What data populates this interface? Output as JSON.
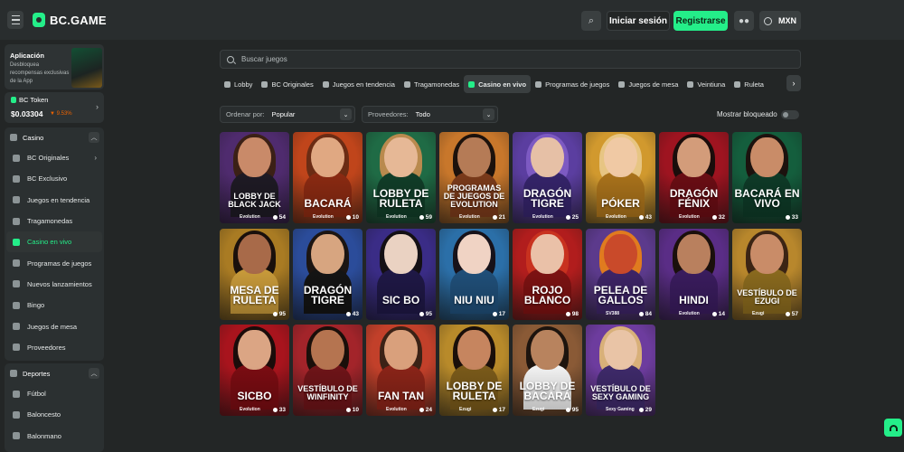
{
  "header": {
    "logo_text": "BC.GAME",
    "login_label": "Iniciar sesión",
    "register_label": "Registrarse",
    "currency": "MXN"
  },
  "sidebar": {
    "app": {
      "title": "Aplicación",
      "desc": "Desbloquea recompensas exclusivas de la App"
    },
    "token": {
      "name": "BC Token",
      "price": "$0.03304",
      "change": "9.53%"
    },
    "casino": {
      "title": "Casino",
      "items": [
        {
          "label": "BC Originales",
          "icon": "bc-originals-icon",
          "chevron": "›"
        },
        {
          "label": "BC Exclusivo",
          "icon": "exclusive-icon"
        },
        {
          "label": "Juegos en tendencia",
          "icon": "fire-icon"
        },
        {
          "label": "Tragamonedas",
          "icon": "slots-icon"
        },
        {
          "label": "Casino en vivo",
          "icon": "live-casino-icon"
        },
        {
          "label": "Programas de juegos",
          "icon": "game-shows-icon"
        },
        {
          "label": "Nuevos lanzamientos",
          "icon": "new-releases-icon"
        },
        {
          "label": "Bingo",
          "icon": "bingo-icon"
        },
        {
          "label": "Juegos de mesa",
          "icon": "table-games-icon"
        },
        {
          "label": "Proveedores",
          "icon": "providers-icon"
        }
      ]
    },
    "sports": {
      "title": "Deportes",
      "items": [
        {
          "label": "Fútbol",
          "icon": "soccer-icon"
        },
        {
          "label": "Baloncesto",
          "icon": "basketball-icon"
        },
        {
          "label": "Balonmano",
          "icon": "handball-icon"
        }
      ]
    }
  },
  "search": {
    "placeholder": "Buscar juegos"
  },
  "tabs": [
    "Lobby",
    "BC Originales",
    "Juegos en tendencia",
    "Tragamonedas",
    "Casino en vivo",
    "Programas de juegos",
    "Juegos de mesa",
    "Veintiuna",
    "Ruleta"
  ],
  "filters": {
    "sort_label": "Ordenar por:",
    "sort_value": "Popular",
    "provider_label": "Proveedores:",
    "provider_value": "Todo",
    "show_locked": "Mostrar bloqueado"
  },
  "games": [
    {
      "title": "Lobby de Black Jack",
      "provider": "Evolution",
      "players": "54",
      "bg": "#4f2b6e",
      "skin": "#c98a69",
      "hair": "#3b2016",
      "outfit": "#1e1a24"
    },
    {
      "title": "Bacará",
      "provider": "Evolution",
      "players": "10",
      "bg": "#c0451b",
      "skin": "#e0a882",
      "hair": "#6b2c14",
      "outfit": "#8a2a12"
    },
    {
      "title": "Lobby de Ruleta",
      "provider": "Evolution",
      "players": "59",
      "bg": "#1f6b45",
      "skin": "#e6b896",
      "hair": "#b98a4e",
      "outfit": "#113d28"
    },
    {
      "title": "Programas de Juegos de Evolution",
      "provider": "Evolution",
      "players": "21",
      "bg": "#c8772b",
      "skin": "#b57b56",
      "hair": "#1d120c",
      "outfit": "#7a3a1a"
    },
    {
      "title": "Dragón Tigre",
      "provider": "Evolution",
      "players": "25",
      "bg": "#5b3ea0",
      "skin": "#e6c0a6",
      "hair": "#7d5ac2",
      "outfit": "#35246a"
    },
    {
      "title": "Póker",
      "provider": "Evolution",
      "players": "43",
      "bg": "#d1992e",
      "skin": "#f0c9a4",
      "hair": "#e7c583",
      "outfit": "#a9721b"
    },
    {
      "title": "Dragón Fénix",
      "provider": "Evolution",
      "players": "32",
      "bg": "#9e1420",
      "skin": "#d39c7a",
      "hair": "#1a0d0b",
      "outfit": "#6a0d14"
    },
    {
      "title": "Bacará en vivo",
      "provider": "",
      "players": "33",
      "bg": "#145e3d",
      "skin": "#c98c68",
      "hair": "#1c120e",
      "outfit": "#0e3a27"
    },
    {
      "title": "Mesa de Ruleta",
      "provider": "",
      "players": "95",
      "bg": "#a97b23",
      "skin": "#a86a49",
      "hair": "#1a100c",
      "outfit": "#c89a3a"
    },
    {
      "title": "Dragón Tigre",
      "provider": "",
      "players": "43",
      "bg": "#2b4c9a",
      "skin": "#d7a580",
      "hair": "#1c1512",
      "outfit": "#141414"
    },
    {
      "title": "Sic Bo",
      "provider": "",
      "players": "95",
      "bg": "#3a2c86",
      "skin": "#ead2c2",
      "hair": "#141014",
      "outfit": "#1f1846"
    },
    {
      "title": "Niu Niu",
      "provider": "",
      "players": "17",
      "bg": "#2b6fa8",
      "skin": "#f0d3c4",
      "hair": "#17121a",
      "outfit": "#204f79"
    },
    {
      "title": "Rojo Blanco",
      "provider": "",
      "players": "98",
      "bg": "#b11d1d",
      "skin": "#eac1a8",
      "hair": "#c8321f",
      "outfit": "#7d1212"
    },
    {
      "title": "Pelea de Gallos",
      "provider": "SV388",
      "players": "84",
      "bg": "#5c3a8c",
      "skin": "#c94a2a",
      "hair": "#e07b1f",
      "outfit": "#3d2466"
    },
    {
      "title": "Hindi",
      "provider": "Evolution",
      "players": "14",
      "bg": "#5a2d86",
      "skin": "#b9805e",
      "hair": "#1a100c",
      "outfit": "#3a1c5e"
    },
    {
      "title": "Vestíbulo de Ezugi",
      "provider": "Ezugi",
      "players": "57",
      "bg": "#b8872c",
      "skin": "#c98c68",
      "hair": "#3b2414",
      "outfit": "#8a6a1e"
    },
    {
      "title": "Sicbo",
      "provider": "Evolution",
      "players": "33",
      "bg": "#a8141d",
      "skin": "#dba584",
      "hair": "#1a0c0a",
      "outfit": "#7a0c12"
    },
    {
      "title": "Vestíbulo de Winfinity",
      "provider": "",
      "players": "10",
      "bg": "#a3242a",
      "skin": "#b57450",
      "hair": "#1a0f0a",
      "outfit": "#6e1418"
    },
    {
      "title": "Fan Tan",
      "provider": "Evolution",
      "players": "24",
      "bg": "#c2402a",
      "skin": "#d9a07c",
      "hair": "#3b2216",
      "outfit": "#8a2418"
    },
    {
      "title": "Lobby de Ruleta",
      "provider": "Ezugi",
      "players": "17",
      "bg": "#b88a2a",
      "skin": "#c6855f",
      "hair": "#1a0f0a",
      "outfit": "#7a5a1a"
    },
    {
      "title": "Lobby de Bacará",
      "provider": "Ezugi",
      "players": "95",
      "bg": "#8a5a36",
      "skin": "#b8835e",
      "hair": "#1d140e",
      "outfit": "#f2f2f2"
    },
    {
      "title": "Vestíbulo de Sexy Gaming",
      "provider": "Sexy Gaming",
      "players": "29",
      "bg": "#6d3c9e",
      "skin": "#e9c4a6",
      "hair": "#d8b079",
      "outfit": "#3e2a6a"
    }
  ]
}
